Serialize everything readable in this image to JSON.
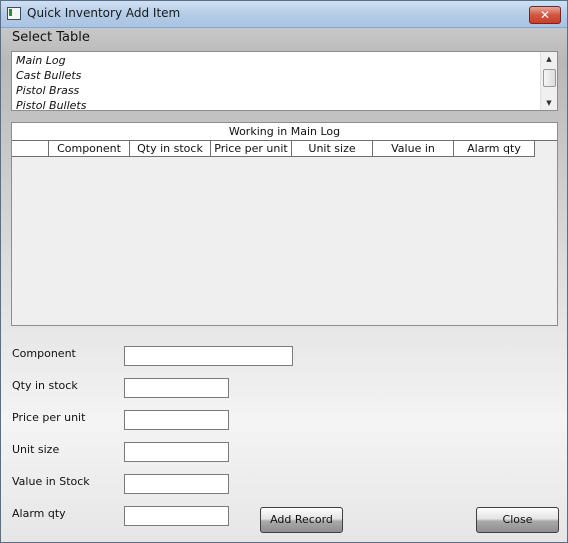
{
  "window": {
    "title": "Quick Inventory Add Item",
    "close_glyph": "✕"
  },
  "select_table": {
    "label": "Select Table",
    "items": [
      "Main Log",
      "Cast Bullets",
      "Pistol Brass",
      "Pistol Bullets"
    ],
    "scroll_up_glyph": "▲",
    "scroll_down_glyph": "▼"
  },
  "grid": {
    "caption": "Working in Main Log",
    "columns": [
      "",
      "Component",
      "Qty in stock",
      "Price per unit",
      "Unit size",
      "Value in",
      "Alarm qty"
    ],
    "rows": []
  },
  "form": {
    "component_label": "Component",
    "qty_label": "Qty in stock",
    "price_label": "Price per unit",
    "unit_label": "Unit size",
    "value_label": "Value in Stock",
    "alarm_label": "Alarm qty",
    "component_value": "",
    "qty_value": "",
    "price_value": "",
    "unit_value": "",
    "value_value": "",
    "alarm_value": ""
  },
  "buttons": {
    "add_record": "Add Record",
    "close": "Close"
  }
}
